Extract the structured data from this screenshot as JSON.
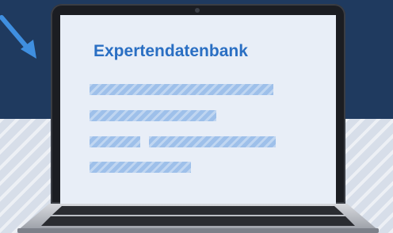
{
  "screen": {
    "title": "Expertendatenbank"
  },
  "icons": [
    "arrow-icon",
    "camera-icon",
    "keyboard-icon"
  ],
  "colors": {
    "background_dark": "#1f3a5f",
    "background_light": "#d7dee9",
    "accent_blue": "#2a6fc3",
    "bar_blue": "#9ec0ea",
    "screen_bg": "#e8eef7",
    "arrow": "#3f8fe0"
  }
}
